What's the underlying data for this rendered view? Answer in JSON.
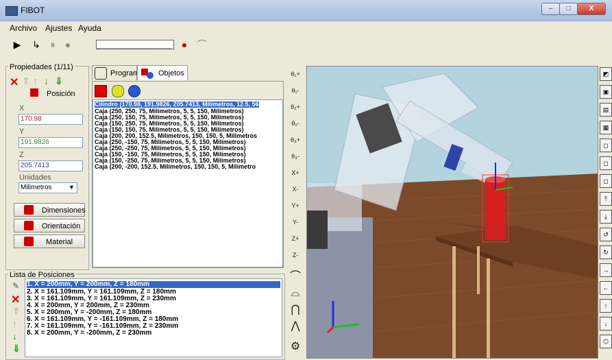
{
  "window": {
    "title": "FIBOT",
    "minimize": "–",
    "maximize": "□",
    "close": "X"
  },
  "menu": [
    "Archivo",
    "Ajustes",
    "Ayuda"
  ],
  "properties": {
    "title": "Propiedades (1/11)",
    "position_label": "Posición",
    "x_label": "X",
    "x_value": "170.98",
    "x_color": "#a0322d",
    "y_label": "Y",
    "y_value": "191.9826",
    "y_color": "#2f8a2f",
    "z_label": "Z",
    "z_value": "205.7413",
    "z_color": "#2a3f9a",
    "units_label": "Unidades",
    "units_value": "Milimetros",
    "buttons": [
      "Dimensiones",
      "Orientación",
      "Material"
    ]
  },
  "tabs": [
    "Programa",
    "Objetos"
  ],
  "objects": [
    "Cilindro (170.98, 191.9826, 205.7413, Milímetros, 12.5, 56",
    "Caja (250, 250, 75, Milímetros, 5, 5, 150, Milímetros)",
    "Caja (250, 150, 75, Milímetros, 5, 5, 150, Milímetros)",
    "Caja (150, 250, 75, Milímetros, 5, 5, 150, Milímetros)",
    "Caja (150, 150, 75, Milímetros, 5, 5, 150, Milímetros)",
    "Caja (200, 200, 152.5, Milímetros, 150, 150, 5, Milímetros",
    "Caja (250, -150, 75, Milímetros, 5, 5, 150, Milímetros)",
    "Caja (250, -250, 75, Milímetros, 5, 5, 150, Milímetros)",
    "Caja (150, -150, 75, Milímetros, 5, 5, 150, Milímetros)",
    "Caja (150, -250, 75, Milímetros, 5, 5, 150, Milímetros)",
    "Caja (200, -200, 152.5, Milímetros, 150, 150, 5, Milímetro"
  ],
  "positions": {
    "title": "Lista de Posiciones",
    "items": [
      "1.  X = 200mm, Y = 200mm, Z = 180mm",
      "2.  X = 161.109mm, Y = 161.109mm, Z = 180mm",
      "3.  X = 161.109mm, Y = 161.109mm, Z = 230mm",
      "4.  X = 200mm, Y = 200mm, Z = 230mm",
      "5.  X = 200mm, Y = -200mm, Z = 180mm",
      "6.  X = 161.109mm, Y = -161.109mm, Z = 180mm",
      "7.  X = 161.109mm, Y = -161.109mm, Z = 230mm",
      "8.  X = 200mm, Y = -200mm, Z = 230mm"
    ]
  },
  "left_tools": [
    "θ₁+",
    "θ₁-",
    "θ₂+",
    "θ₂-",
    "θ₃+",
    "θ₃-",
    "X+",
    "X-",
    "Y+",
    "Y-",
    "Z+",
    "Z-"
  ],
  "colors": {
    "selection": "#3169c6",
    "floor": "#7a4a2a",
    "sky": "#b3d4df",
    "cylinder": "#d42020"
  }
}
